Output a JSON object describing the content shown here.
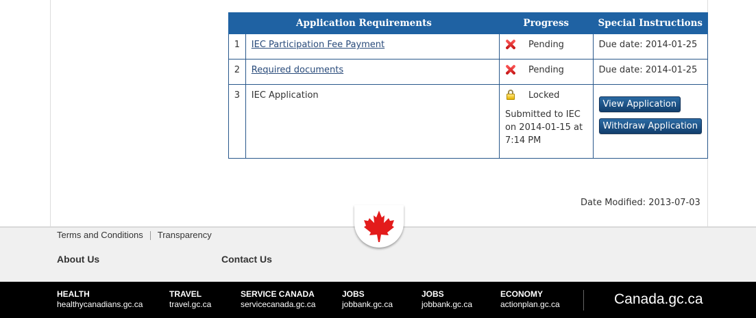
{
  "table": {
    "headers": [
      "Application Requirements",
      "Progress",
      "Special Instructions"
    ],
    "rows": [
      {
        "num": "1",
        "requirement": "IEC Participation Fee Payment",
        "status_icon": "x-icon",
        "status": "Pending",
        "instruction": "Due date: 2014-01-25"
      },
      {
        "num": "2",
        "requirement": "Required documents",
        "status_icon": "x-icon",
        "status": "Pending",
        "instruction": "Due date: 2014-01-25"
      },
      {
        "num": "3",
        "requirement": "IEC Application",
        "status_icon": "lock-icon",
        "status": "Locked",
        "submitted": "Submitted to IEC on 2014-01-15 at 7:14 PM",
        "buttons": [
          "View Application",
          "Withdraw Application"
        ]
      }
    ]
  },
  "date_modified": "Date Modified: 2013-07-03",
  "footer": {
    "links": [
      "Terms and Conditions",
      "Transparency"
    ],
    "about": "About Us",
    "contact": "Contact Us",
    "columns": [
      {
        "title": "HEALTH",
        "url": "healthycanadians.gc.ca"
      },
      {
        "title": "TRAVEL",
        "url": "travel.gc.ca"
      },
      {
        "title": "SERVICE CANADA",
        "url": "servicecanada.gc.ca"
      },
      {
        "title": "JOBS",
        "url": "jobbank.gc.ca"
      },
      {
        "title": "JOBS",
        "url": "jobbank.gc.ca"
      },
      {
        "title": "ECONOMY",
        "url": "actionplan.gc.ca"
      }
    ],
    "brand": "Canada.gc.ca"
  },
  "colors": {
    "header_blue": "#1f62a3",
    "leaf_red": "#e31b1b",
    "footer_dark": "#000000"
  }
}
